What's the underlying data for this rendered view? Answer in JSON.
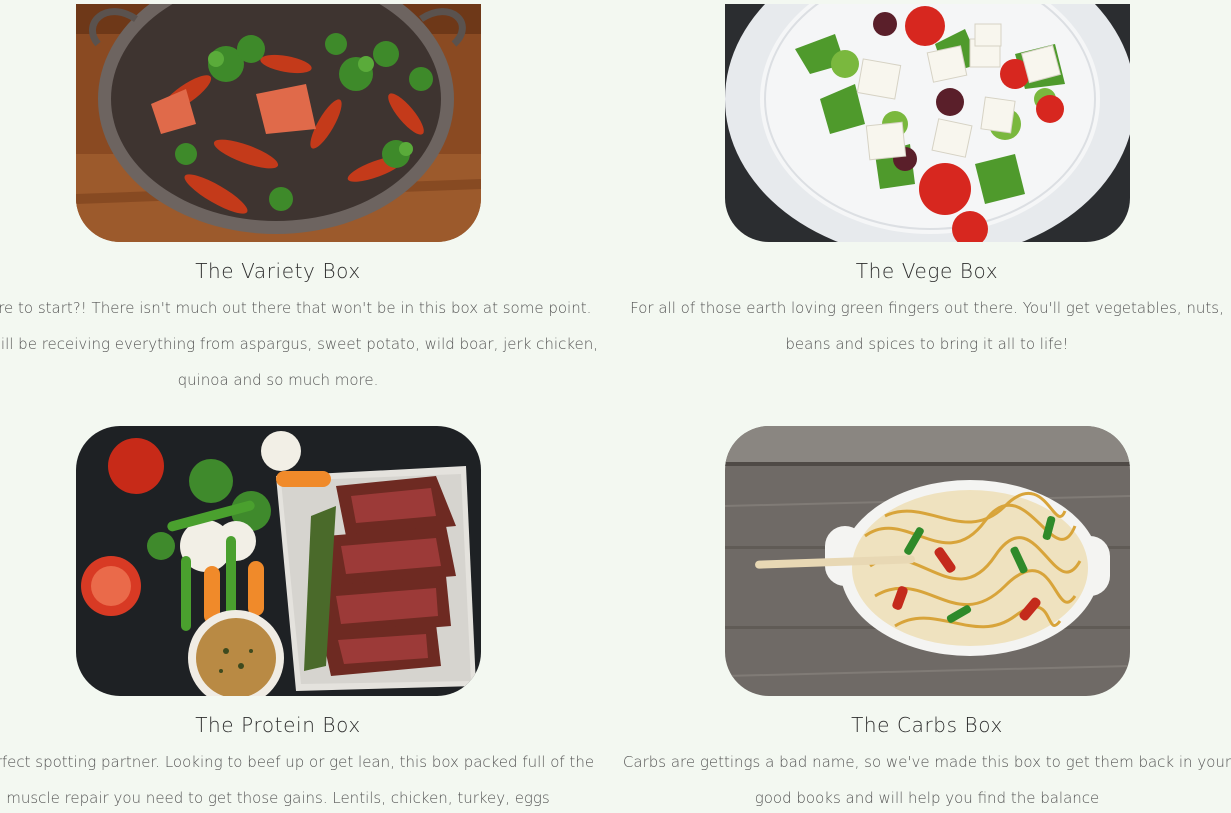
{
  "boxes": [
    {
      "title": "The Variety Box",
      "description": "Where to start?! There isn't much out there that won't be in this box at some point. You will be receiving everything from aspargus, sweet potato, wild boar, jerk chicken, quinoa and so much more.",
      "image": "wok-chili-stir-fry-photo"
    },
    {
      "title": "The Vege Box",
      "description": "For all of those earth loving green fingers out there. You'll get vegetables, nuts, beans and spices to bring it all to life!",
      "image": "feta-salad-plate-photo"
    },
    {
      "title": "The Protein Box",
      "description": "A perfect spotting partner. Looking to beef up or get lean, this box packed full of the muscle repair you need to get those gains. Lentils, chicken, turkey, eggs",
      "image": "steak-vegetables-photo"
    },
    {
      "title": "The Carbs Box",
      "description": "Carbs are gettings a bad name, so we've made this box to get them back in your good books and will help you find the balance",
      "image": "noodle-dish-photo"
    }
  ],
  "colors": {
    "background": "#f3f8f1",
    "title": "#2e2e2e",
    "text": "#555555"
  }
}
